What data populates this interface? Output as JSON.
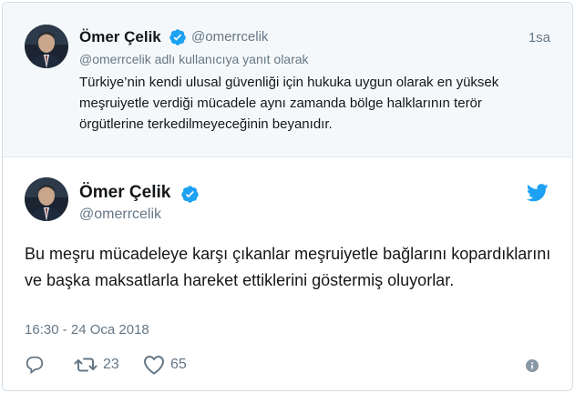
{
  "parent_tweet": {
    "author_name": "Ömer Çelik",
    "handle": "@omerrcelik",
    "time": "1sa",
    "reply_context": "@omerrcelik adlı kullanıcıya yanıt olarak",
    "text": "Türkiye’nin kendi ulusal güvenliği için hukuka uygun olarak en yüksek meşruiyetle verdiği mücadele aynı zamanda bölge halklarının terör örgütlerine terkedilmeyeceğinin beyanıdır."
  },
  "main_tweet": {
    "author_name": "Ömer Çelik",
    "handle": "@omerrcelik",
    "text": "Bu meşru mücadeleye karşı çıkanlar meşruiyetle bağlarını kopardıklarını ve başka maksatlarla hareket ettiklerini göstermiş oluyorlar.",
    "timestamp": "16:30 - 24 Oca 2018",
    "retweet_count": "23",
    "like_count": "65"
  },
  "icons": {
    "verified": "verified-badge-icon",
    "brand": "twitter-bird-icon",
    "reply": "reply-icon",
    "retweet": "retweet-icon",
    "like": "heart-icon",
    "info": "info-icon"
  },
  "colors": {
    "verified_blue": "#1da1f2",
    "text": "#14171a",
    "muted": "#657786",
    "parent_bg": "#f5f8fa"
  }
}
